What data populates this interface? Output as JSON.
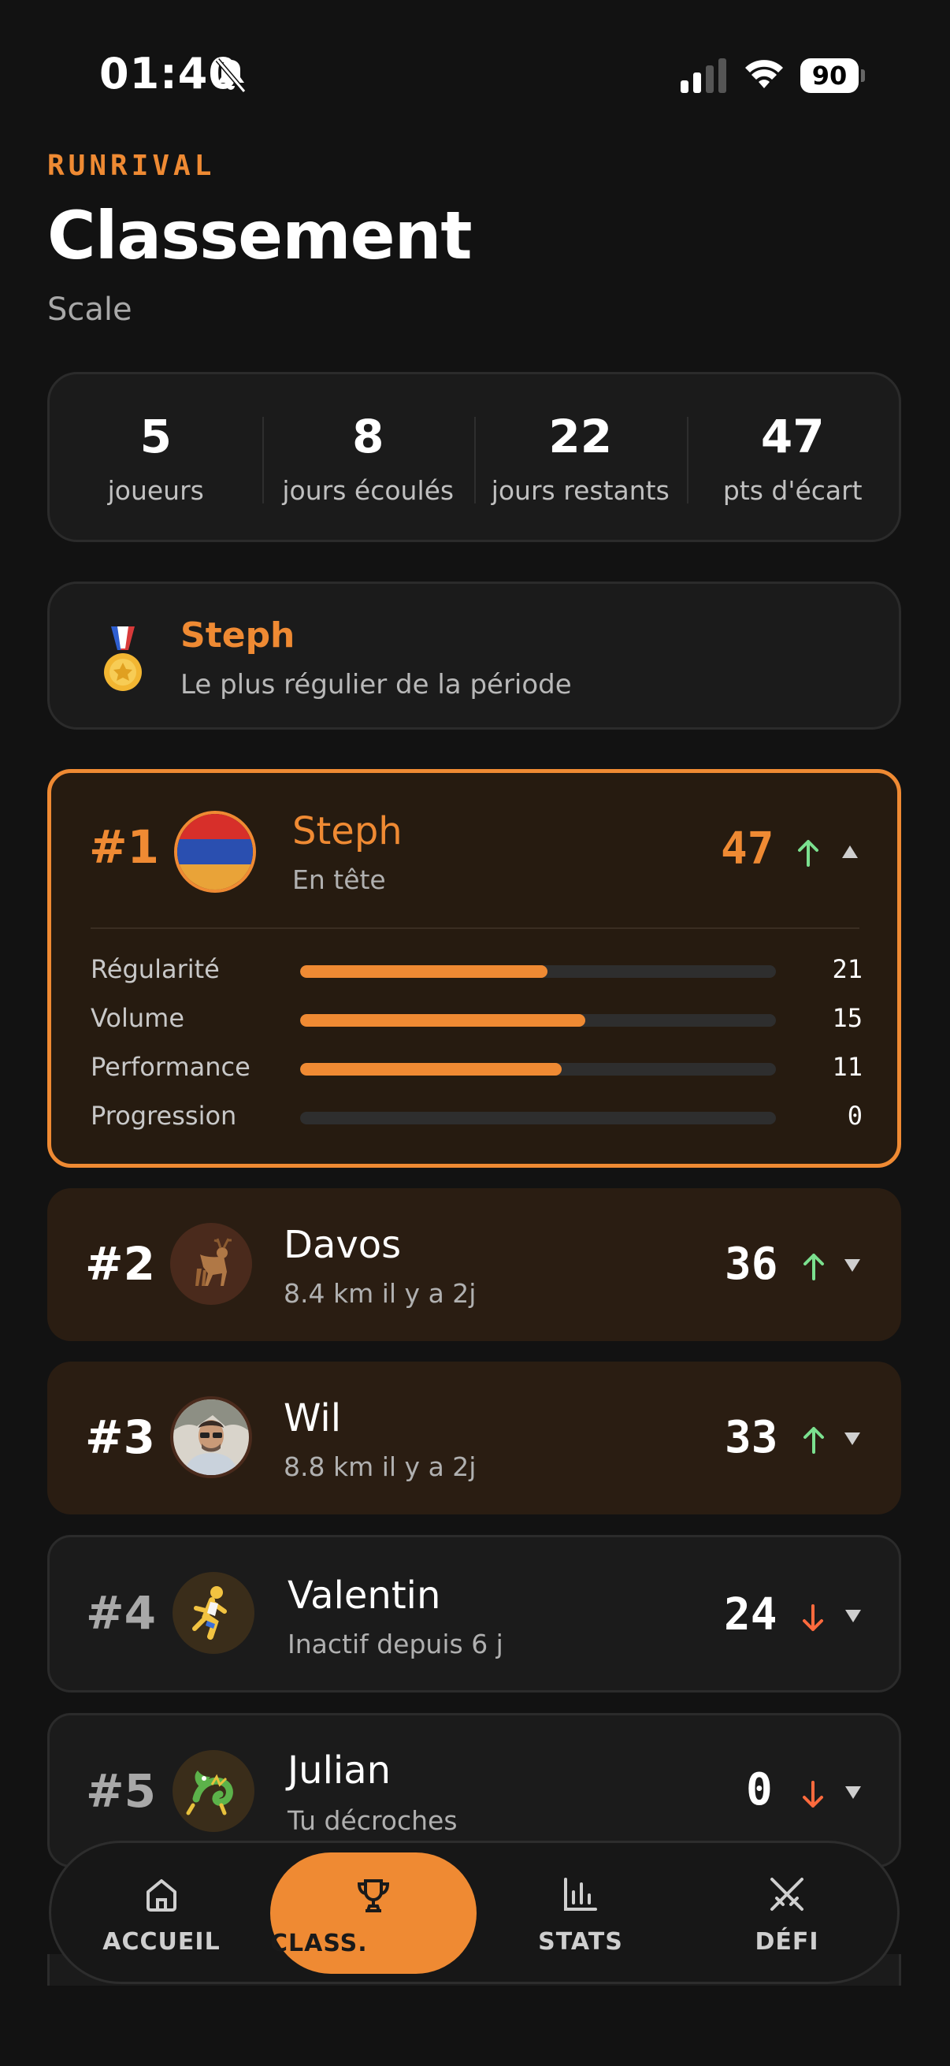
{
  "status_bar": {
    "time": "01:40",
    "battery": "90"
  },
  "header": {
    "brand": "RUNRIVAL",
    "title": "Classement",
    "subtitle": "Scale"
  },
  "stats": [
    {
      "value": "5",
      "label": "joueurs"
    },
    {
      "value": "8",
      "label": "jours écoulés"
    },
    {
      "value": "22",
      "label": "jours restants"
    },
    {
      "value": "47",
      "label": "pts d'écart"
    }
  ],
  "regular": {
    "name": "Steph",
    "description": "Le plus régulier de la période"
  },
  "ranking": [
    {
      "rank": "#1",
      "name": "Steph",
      "sub": "En tête",
      "score": "47",
      "trend": "up",
      "expanded": true,
      "metrics": [
        {
          "label": "Régularité",
          "value": "21",
          "fill": 0.52
        },
        {
          "label": "Volume",
          "value": "15",
          "fill": 0.6
        },
        {
          "label": "Performance",
          "value": "11",
          "fill": 0.55
        },
        {
          "label": "Progression",
          "value": "0",
          "fill": 0
        }
      ]
    },
    {
      "rank": "#2",
      "name": "Davos",
      "sub": "8.4 km il y a 2j",
      "score": "36",
      "trend": "up"
    },
    {
      "rank": "#3",
      "name": "Wil",
      "sub": "8.8 km il y a 2j",
      "score": "33",
      "trend": "up"
    },
    {
      "rank": "#4",
      "name": "Valentin",
      "sub": "Inactif depuis 6 j",
      "score": "24",
      "trend": "down"
    },
    {
      "rank": "#5",
      "name": "Julian",
      "sub": "Tu décroches",
      "score": "0",
      "trend": "down"
    }
  ],
  "nav": [
    {
      "label": "ACCUEIL",
      "icon": "home-icon"
    },
    {
      "label": "CLASS.",
      "icon": "trophy-icon",
      "active": true
    },
    {
      "label": "STATS",
      "icon": "bar-chart-icon"
    },
    {
      "label": "DÉFI",
      "icon": "crossed-swords-icon"
    }
  ],
  "colors": {
    "accent": "#ef8a33",
    "up": "#7be08f",
    "down": "#ff6a3d",
    "background": "#121212"
  }
}
